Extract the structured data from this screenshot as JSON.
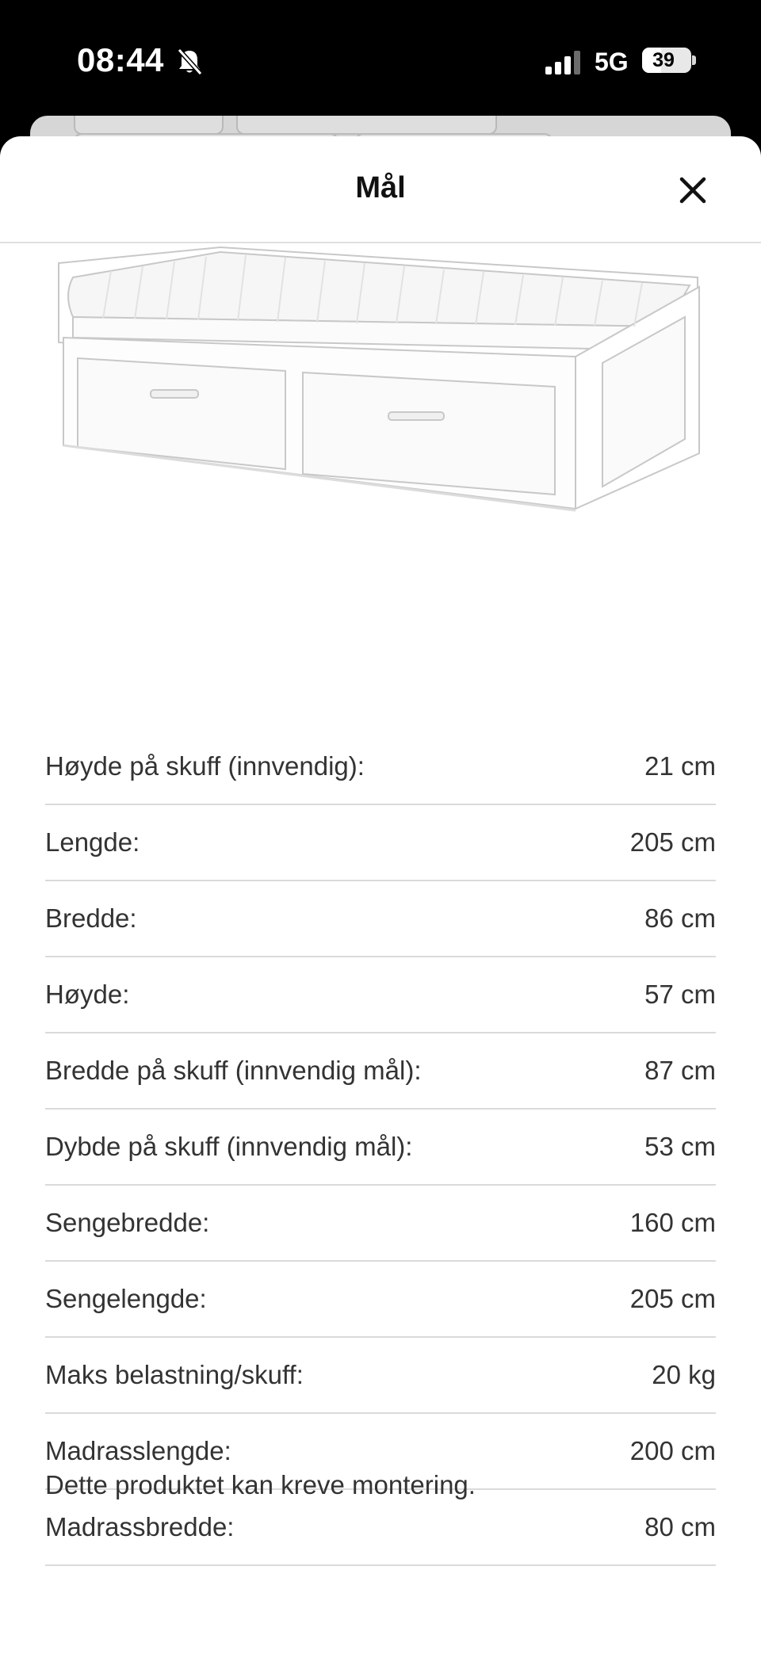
{
  "status_bar": {
    "time": "08:44",
    "network": "5G",
    "battery": "39",
    "battery_fraction": 0.39,
    "icons": [
      "bell-slash-icon",
      "signal-bars-icon",
      "battery-icon"
    ]
  },
  "sheet": {
    "title": "Mål",
    "close_icon": "close-icon"
  },
  "dimensions": [
    {
      "label": "Høyde på skuff (innvendig):",
      "value": "21 cm"
    },
    {
      "label": "Lengde:",
      "value": "205 cm"
    },
    {
      "label": "Bredde:",
      "value": "86 cm"
    },
    {
      "label": "Høyde:",
      "value": "57 cm"
    },
    {
      "label": "Bredde på skuff (innvendig mål):",
      "value": "87 cm"
    },
    {
      "label": "Dybde på skuff (innvendig mål):",
      "value": "53 cm"
    },
    {
      "label": "Sengebredde:",
      "value": "160 cm"
    },
    {
      "label": "Sengelengde:",
      "value": "205 cm"
    },
    {
      "label": "Maks belastning/skuff:",
      "value": "20 kg"
    },
    {
      "label": "Madrasslengde:",
      "value": "200 cm"
    },
    {
      "label": "Madrassbredde:",
      "value": "80 cm"
    }
  ],
  "note": "Dette produktet kan kreve montering."
}
